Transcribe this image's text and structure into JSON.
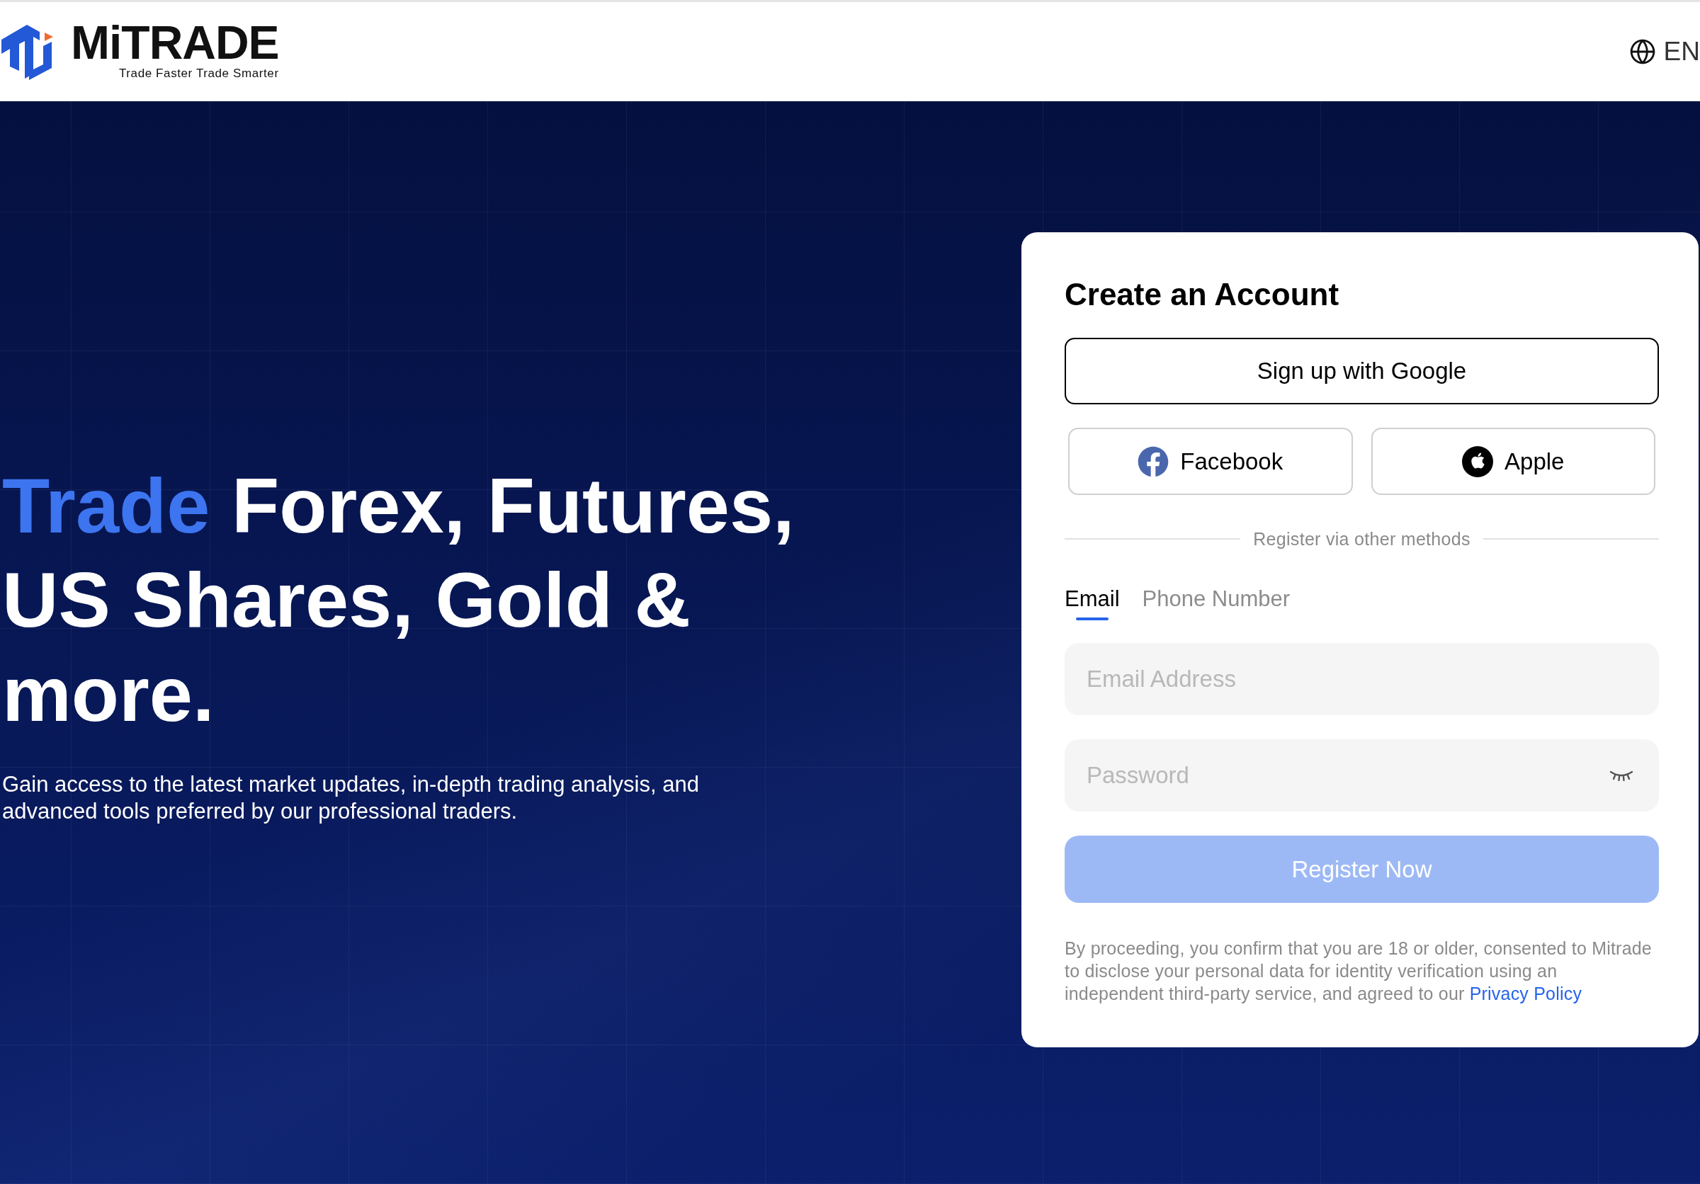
{
  "header": {
    "logo": {
      "wordmark": "MiTRADE",
      "tagline": "Trade Faster Trade Smarter"
    },
    "language": "EN"
  },
  "hero": {
    "headline": {
      "accent": "Trade",
      "rest": "Forex, Futures, US Shares, Gold & more."
    },
    "description": "Gain access to the latest market updates, in-depth trading analysis, and advanced tools preferred by our professional traders."
  },
  "signup": {
    "title": "Create an Account",
    "google_button": "Sign up with Google",
    "social_buttons": [
      {
        "kind": "facebook",
        "label": "Facebook"
      },
      {
        "kind": "apple",
        "label": "Apple"
      }
    ],
    "divider": "Register via other methods",
    "tabs": [
      {
        "label": "Email",
        "selected": true
      },
      {
        "label": "Phone Number",
        "selected": false
      }
    ],
    "fields": [
      {
        "kind": "email",
        "placeholder": "Email Address"
      },
      {
        "kind": "password",
        "placeholder": "Password"
      }
    ],
    "submit": {
      "label": "Register Now",
      "disabled": true
    },
    "legal": {
      "text": "By proceeding, you confirm that you are 18 or older, consented to Mitrade to disclose your personal data for identity verification using an independent third-party service, and agreed to our",
      "link": "Privacy Policy"
    }
  }
}
